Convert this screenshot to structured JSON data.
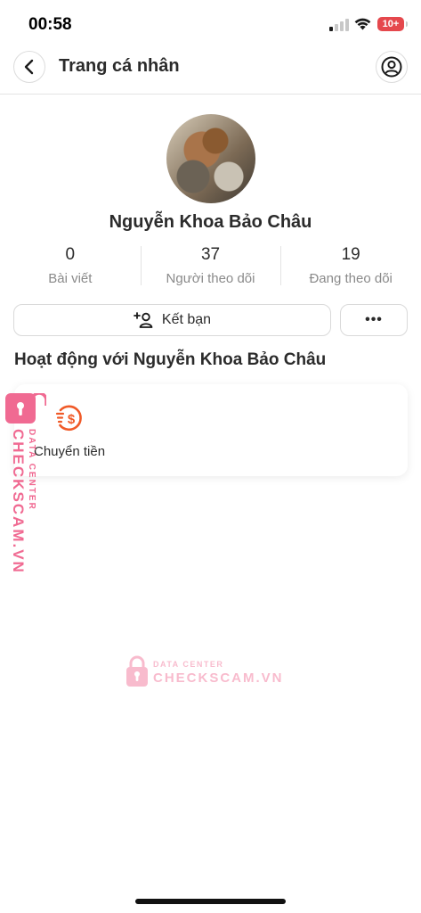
{
  "status_bar": {
    "time": "00:58",
    "battery": "10+"
  },
  "header": {
    "title": "Trang cá nhân"
  },
  "profile": {
    "name": "Nguyễn Khoa Bảo Châu",
    "stats": [
      {
        "count": "0",
        "label": "Bài viết"
      },
      {
        "count": "37",
        "label": "Người theo dõi"
      },
      {
        "count": "19",
        "label": "Đang theo dõi"
      }
    ]
  },
  "actions": {
    "add_friend": "Kết bạn",
    "more": "•••"
  },
  "activity": {
    "title": "Hoạt động với Nguyễn Khoa Bảo Châu",
    "items": [
      {
        "label": "Chuyển tiền",
        "icon": "money-transfer-icon"
      }
    ]
  },
  "watermark": {
    "tag": "DATA CENTER",
    "brand": "CHECKSCAM.VN",
    "color": "#f06a92"
  },
  "colors": {
    "accent": "#f05a28",
    "battery": "#e5484d"
  }
}
